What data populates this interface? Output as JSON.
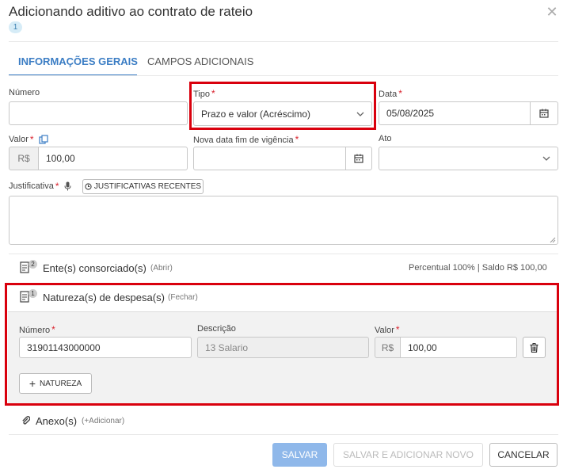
{
  "dialog": {
    "title": "Adicionando aditivo ao contrato de rateio",
    "badge": "1",
    "close_glyph": "✕"
  },
  "tabs": [
    {
      "label": "INFORMAÇÕES GERAIS",
      "active": true
    },
    {
      "label": "CAMPOS ADICIONAIS",
      "active": false
    }
  ],
  "form": {
    "numero": {
      "label": "Número",
      "value": ""
    },
    "tipo": {
      "label": "Tipo",
      "value": "Prazo e valor (Acréscimo)"
    },
    "data": {
      "label": "Data",
      "value": "05/08/2025"
    },
    "valor": {
      "label": "Valor",
      "prefix": "R$",
      "value": "100,00"
    },
    "nova_data": {
      "label": "Nova data fim de vigência",
      "value": ""
    },
    "ato": {
      "label": "Ato",
      "value": ""
    },
    "justificativa": {
      "label": "Justificativa",
      "recent_button": "JUSTIFICATIVAS RECENTES",
      "value": ""
    },
    "required_mark": "*"
  },
  "entes": {
    "count": "2",
    "title": "Ente(s) consorciado(s)",
    "toggle": "(Abrir)",
    "summary": "Percentual 100% | Saldo R$ 100,00"
  },
  "natureza": {
    "count": "1",
    "title": "Natureza(s) de despesa(s)",
    "toggle": "(Fechar)",
    "col_numero": "Número",
    "col_descricao": "Descrição",
    "col_valor": "Valor",
    "row": {
      "numero": "31901143000000",
      "descricao": "13 Salario",
      "prefix": "R$",
      "valor": "100,00"
    },
    "add_button": "NATUREZA"
  },
  "anexo": {
    "title": "Anexo(s)",
    "toggle": "(+Adicionar)"
  },
  "footer": {
    "save": "SALVAR",
    "save_new": "SALVAR E ADICIONAR NOVO",
    "cancel": "CANCELAR"
  },
  "colors": {
    "accent": "#3b7dc4",
    "required": "#d9232e",
    "highlight": "#d9000d",
    "primary_disabled": "#8fb8ea"
  }
}
